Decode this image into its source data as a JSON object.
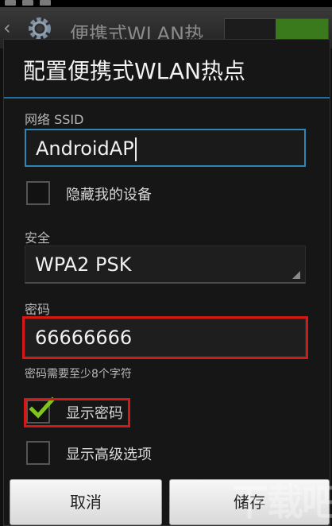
{
  "background": {
    "screen_title": "便携式WLAN热"
  },
  "dialog": {
    "title": "配置便携式WLAN热点",
    "ssid": {
      "label": "网络 SSID",
      "value": "AndroidAP"
    },
    "hide_device": {
      "label": "隐藏我的设备",
      "checked": false
    },
    "security": {
      "label": "安全",
      "selected": "WPA2 PSK"
    },
    "password": {
      "label": "密码",
      "value": "66666666",
      "hint": "密码需要至少8个字符"
    },
    "show_password": {
      "label": "显示密码",
      "checked": true
    },
    "show_advanced": {
      "label": "显示高级选项",
      "checked": false
    },
    "buttons": {
      "cancel": "取消",
      "save": "储存"
    }
  },
  "watermark": "下载吧",
  "colors": {
    "accent": "#2f85b3",
    "highlight": "#d41818",
    "check": "#7ec61e",
    "dialog_bg": "#161616"
  },
  "icons": [
    "back-chevron-icon",
    "gear-icon",
    "checkmark-icon",
    "dropdown-corner-icon"
  ]
}
